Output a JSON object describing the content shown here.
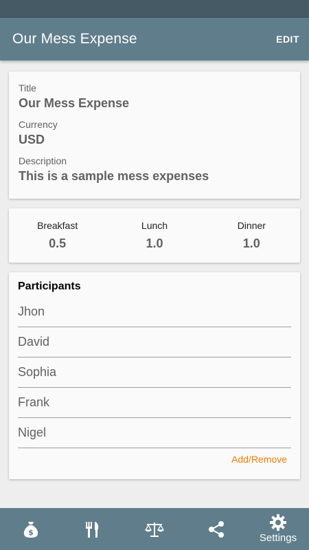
{
  "app_bar": {
    "title": "Our Mess Expense",
    "edit_label": "EDIT"
  },
  "info": {
    "title_label": "Title",
    "title_value": "Our Mess Expense",
    "currency_label": "Currency",
    "currency_value": "USD",
    "description_label": "Description",
    "description_value": "This is a sample mess expenses"
  },
  "meals": [
    {
      "label": "Breakfast",
      "value": "0.5"
    },
    {
      "label": "Lunch",
      "value": "1.0"
    },
    {
      "label": "Dinner",
      "value": "1.0"
    }
  ],
  "participants": {
    "heading": "Participants",
    "names": [
      "Jhon",
      "David",
      "Sophia",
      "Frank",
      "Nigel"
    ],
    "add_remove_label": "Add/Remove"
  },
  "bottom_nav": {
    "items": [
      {
        "icon": "money-bag-icon"
      },
      {
        "icon": "fork-knife-icon"
      },
      {
        "icon": "balance-scale-icon"
      },
      {
        "icon": "share-icon"
      },
      {
        "icon": "gear-icon",
        "label": "Settings"
      }
    ]
  },
  "colors": {
    "primary": "#607d8b",
    "status_bar": "#455a64",
    "accent": "#f57c00"
  }
}
